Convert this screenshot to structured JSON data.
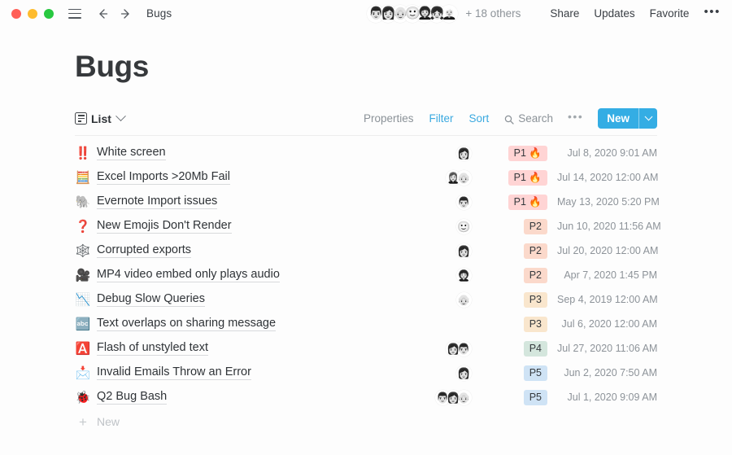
{
  "titlebar": {
    "window_controls": [
      "close",
      "minimize",
      "maximize"
    ],
    "menu_icon": "hamburger-icon",
    "back_icon": "arrow-left-icon",
    "forward_icon": "arrow-right-icon",
    "breadcrumb": "Bugs",
    "collaborators": [
      "👨",
      "👩",
      "👴",
      "🙂",
      "👩‍🦱",
      "👧",
      "👱‍♀️"
    ],
    "others_label": "+ 18 others",
    "share_label": "Share",
    "updates_label": "Updates",
    "favorite_label": "Favorite",
    "more_label": "•••"
  },
  "page": {
    "title": "Bugs"
  },
  "viewbar": {
    "view_label": "List",
    "view_icon": "list-icon",
    "properties_label": "Properties",
    "filter_label": "Filter",
    "sort_label": "Sort",
    "search_label": "Search",
    "search_icon": "search-icon",
    "more_label": "•••",
    "new_label": "New",
    "new_dropdown_icon": "chevron-down-icon",
    "accent_color": "#3aa9e0",
    "new_button_color": "#34ade4"
  },
  "tag_colors": {
    "P1": "#ffd4d4",
    "P2": "#fbd9cb",
    "P3": "#f9e6cd",
    "P4": "#d4e6dd",
    "P5": "#cfe3f5"
  },
  "rows": [
    {
      "icon": "‼️",
      "icon_name": "double-exclamation-icon",
      "title": "White screen",
      "avatars": [
        "👩"
      ],
      "tag": "P1 🔥",
      "priority": "P1",
      "date": "Jul 8, 2020 9:01 AM"
    },
    {
      "icon": "🧮",
      "icon_name": "abacus-icon",
      "title": "Excel Imports >20Mb Fail",
      "avatars": [
        "👩‍🦰",
        "👴"
      ],
      "tag": "P1 🔥",
      "priority": "P1",
      "date": "Jul 14, 2020 12:00 AM"
    },
    {
      "icon": "🐘",
      "icon_name": "elephant-icon",
      "title": "Evernote Import issues",
      "avatars": [
        "👨"
      ],
      "tag": "P1 🔥",
      "priority": "P1",
      "date": "May 13, 2020 5:20 PM"
    },
    {
      "icon": "❓",
      "icon_name": "question-mark-icon",
      "title": "New Emojis Don't Render",
      "avatars": [
        "🙂"
      ],
      "tag": "P2",
      "priority": "P2",
      "date": "Jun 10, 2020 11:56 AM"
    },
    {
      "icon": "🕸️",
      "icon_name": "spider-web-icon",
      "title": "Corrupted exports",
      "avatars": [
        "👩"
      ],
      "tag": "P2",
      "priority": "P2",
      "date": "Jul 20, 2020 12:00 AM"
    },
    {
      "icon": "🎥",
      "icon_name": "movie-camera-icon",
      "title": "MP4 video embed only plays audio",
      "avatars": [
        "👩‍🦱"
      ],
      "tag": "P2",
      "priority": "P2",
      "date": "Apr 7, 2020 1:45 PM"
    },
    {
      "icon": "📉",
      "icon_name": "chart-decreasing-icon",
      "title": "Debug Slow Queries",
      "avatars": [
        "👴"
      ],
      "tag": "P3",
      "priority": "P3",
      "date": "Sep 4, 2019 12:00 AM"
    },
    {
      "icon": "🔤",
      "icon_name": "abcd-input-icon",
      "title": "Text overlaps on sharing message",
      "avatars": [],
      "tag": "P3",
      "priority": "P3",
      "date": "Jul 6, 2020 12:00 AM"
    },
    {
      "icon": "🅰️",
      "icon_name": "a-button-icon",
      "title": "Flash of unstyled text",
      "avatars": [
        "👩",
        "👨"
      ],
      "tag": "P4",
      "priority": "P4",
      "date": "Jul 27, 2020 11:06 AM"
    },
    {
      "icon": "📩",
      "icon_name": "envelope-with-arrow-icon",
      "title": "Invalid Emails Throw an Error",
      "avatars": [
        "👩"
      ],
      "tag": "P5",
      "priority": "P5",
      "date": "Jun 2, 2020 7:50 AM"
    },
    {
      "icon": "🐞",
      "icon_name": "lady-beetle-icon",
      "title": "Q2 Bug Bash",
      "avatars": [
        "👨",
        "👩",
        "👴"
      ],
      "tag": "P5",
      "priority": "P5",
      "date": "Jul 1, 2020 9:09 AM"
    }
  ],
  "new_row": {
    "plus_icon": "plus-icon",
    "label": "New"
  }
}
